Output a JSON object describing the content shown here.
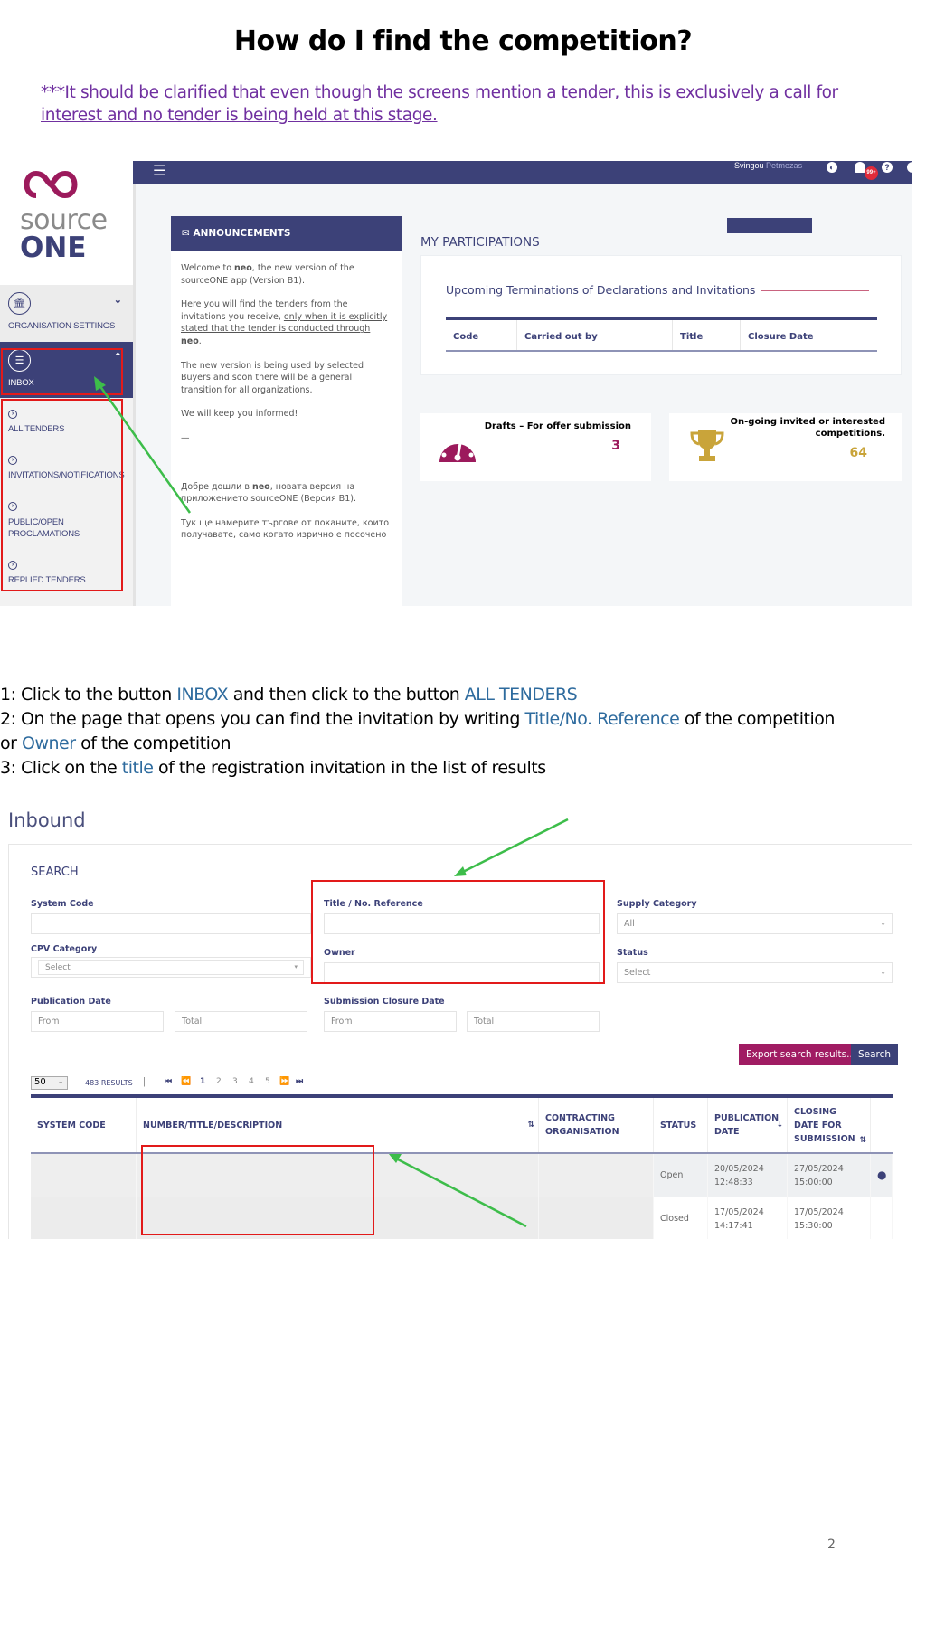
{
  "document": {
    "title": "How do I find the competition?",
    "note": "***It should be clarified that even though the screens mention a tender, this is exclusively a call for interest and no tender is being held at this stage.",
    "page_number": "2"
  },
  "screenshot_dashboard": {
    "logo": {
      "line1": "source",
      "line2": "ONE"
    },
    "topbar": {
      "user_first": "Svingou",
      "user_last": "Petmezas",
      "notification_badge": "99+"
    },
    "sidebar": {
      "organisation_settings": "ORGANISATION SETTINGS",
      "inbox": "INBOX",
      "submenu": [
        {
          "label": "ALL TENDERS"
        },
        {
          "label": "INVITATIONS/NOTIFICATIONS"
        },
        {
          "label": "PUBLIC/OPEN PROCLAMATIONS"
        },
        {
          "label": "REPLIED TENDERS"
        }
      ]
    },
    "announcements": {
      "header": "ANNOUNCEMENTS",
      "p1_pre": "Welcome to ",
      "p1_bold": "neo",
      "p1_post": ", the new version of the sourceONE app (Version B1).",
      "p2_pre": "Here you will find the tenders from the invitations you receive, ",
      "p2_underline": "only when it is explicitly stated that the tender is conducted through ",
      "p2_bold": "neo",
      "p2_post": ".",
      "p3": "The new version is being used by selected Buyers and soon there will be a general transition for all organizations.",
      "p4": "We will keep you informed!",
      "p5": "—",
      "p6_pre": "Добре дошли в ",
      "p6_bold": "neo",
      "p6_post": ", новата версия на приложението sourceONE (Версия B1).",
      "p7": "Тук ще намерите търгове от поканите, които получавате, само когато изрично е посочено"
    },
    "participations": {
      "title": "MY PARTICIPATIONS",
      "subtitle": "Upcoming Terminations of Declarations and Invitations",
      "columns": [
        "Code",
        "Carried out by",
        "Title",
        "Closure Date"
      ]
    },
    "stats": [
      {
        "label": "Drafts – For offer submission",
        "value": "3",
        "color": "#9c1a5c",
        "icon": "dashboard-gauge-icon"
      },
      {
        "label": "On-going invited or interested competitions.",
        "value": "64",
        "color": "#c9a43a",
        "icon": "trophy-icon"
      }
    ]
  },
  "instructions": {
    "step1": {
      "pre": "1: Click to the button ",
      "hl1": "INBOX",
      "mid": " and then click to the button  ",
      "hl2": "ALL TENDERS"
    },
    "step2": {
      "pre": "2: On the page that opens you can find the invitation by writing ",
      "hl1": "Title/No. Reference",
      "mid": " of the competition",
      "line2_pre": "or  ",
      "hl2": "Owner",
      "post": " of the competition"
    },
    "step3": {
      "pre": "3: Click on the ",
      "hl": "title",
      "post": " of the registration invitation in the list of results"
    }
  },
  "screenshot_search": {
    "page_title": "Inbound",
    "section_title": "SEARCH",
    "fields": {
      "system_code": {
        "label": "System Code",
        "value": ""
      },
      "title_ref": {
        "label": "Title / No. Reference",
        "value": ""
      },
      "supply_category": {
        "label": "Supply Category",
        "value": "All"
      },
      "cpv_category": {
        "label": "CPV Category",
        "value": "Select"
      },
      "owner": {
        "label": "Owner",
        "value": ""
      },
      "status": {
        "label": "Status",
        "value": "Select"
      },
      "publication_date": {
        "label": "Publication Date",
        "from": "From",
        "to": "Total"
      },
      "submission_closure_date": {
        "label": "Submission Closure Date",
        "from": "From",
        "to": "Total"
      }
    },
    "buttons": {
      "export": "Export search results...",
      "search": "Search"
    },
    "export_color": "#a01c63",
    "search_color": "#3c4178",
    "pagination": {
      "page_size": "50",
      "results": "483 RESULTS",
      "pages": [
        "1",
        "2",
        "3",
        "4",
        "5"
      ],
      "current_page": "1"
    },
    "table": {
      "columns": [
        "SYSTEM CODE",
        "NUMBER/TITLE/DESCRIPTION",
        "CONTRACTING ORGANISATION",
        "STATUS",
        "PUBLICATION DATE",
        "CLOSING DATE FOR SUBMISSION",
        ""
      ],
      "rows": [
        {
          "system_code": "",
          "title": "",
          "organisation": "",
          "status": "Open",
          "publication_date": "20/05/2024",
          "publication_time": "12:48:33",
          "closing_date": "27/05/2024",
          "closing_time": "15:00:00",
          "action_icon": "globe-icon"
        },
        {
          "system_code": "",
          "title": "",
          "organisation": "",
          "status": "Closed",
          "publication_date": "17/05/2024",
          "publication_time": "14:17:41",
          "closing_date": "17/05/2024",
          "closing_time": "15:30:00",
          "action_icon": ""
        }
      ]
    }
  }
}
